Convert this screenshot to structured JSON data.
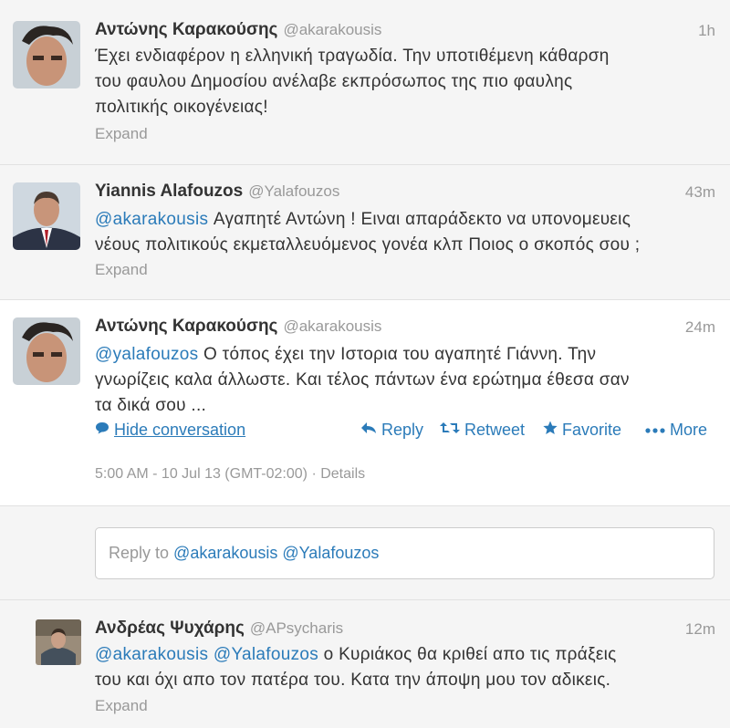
{
  "tweets": [
    {
      "name": "Αντώνης Καρακούσης",
      "handle": "@akarakousis",
      "time": "1h",
      "text_lines": [
        "Έχει ενδιαφέρον η ελληνική τραγωδία. Την υποτιθέμενη κάθαρση",
        "του φαυλου  Δημοσίου ανέλαβε εκπρόσωπος της πιο φαυλης",
        "πολιτικής οικογένειας!"
      ],
      "expand": "Expand",
      "avatar_icon": "portrait-photo"
    },
    {
      "name": "Yiannis Alafouzos",
      "handle": "@Yalafouzos",
      "time": "43m",
      "mention": "@akarakousis",
      "text_line1": " Αγαπητέ Αντώνη ! Ειναι απαράδεκτο να υπονομευεις",
      "text_line2": "νέους πολιτικούς εκμεταλλευόμενος γονέα κλπ Ποιος ο σκοπός σου ;",
      "expand": "Expand",
      "avatar_icon": "portrait-photo"
    },
    {
      "name": "Αντώνης Καρακούσης",
      "handle": "@akarakousis",
      "time": "24m",
      "mention": "@yalafouzos",
      "text_line1": " Ο τόπος έχει την Ιστορια του αγαπητέ Γιάννη. Την",
      "text_line2": "γνωρίζεις καλα  άλλωστε. Και τέλος πάντων ένα ερώτημα έθεσα σαν",
      "text_line3": "τα δικά σου ...",
      "hide_conversation": "Hide conversation",
      "reply": "Reply",
      "retweet": "Retweet",
      "favorite": "Favorite",
      "more": "More",
      "meta": "5:00 AM - 10 Jul 13 (GMT-02:00) · Details",
      "avatar_icon": "portrait-photo"
    },
    {
      "name": "Ανδρέας Ψυχάρης",
      "handle": "@APsycharis",
      "time": "12m",
      "mention1": "@akarakousis",
      "mention2": "@Yalafouzos",
      "text_line1": " ο Κυριάκος θα κριθεί απο τις πράξεις",
      "text_line2": "του και όχι απο τον πατέρα του. Κατα την άποψη μου τον αδικεις.",
      "expand": "Expand",
      "avatar_icon": "portrait-photo"
    }
  ],
  "reply_box": {
    "prefix": "Reply to ",
    "mentions": "@akarakousis @Yalafouzos"
  },
  "colors": {
    "link": "#2b7bb9",
    "muted": "#999999",
    "text": "#333333"
  }
}
